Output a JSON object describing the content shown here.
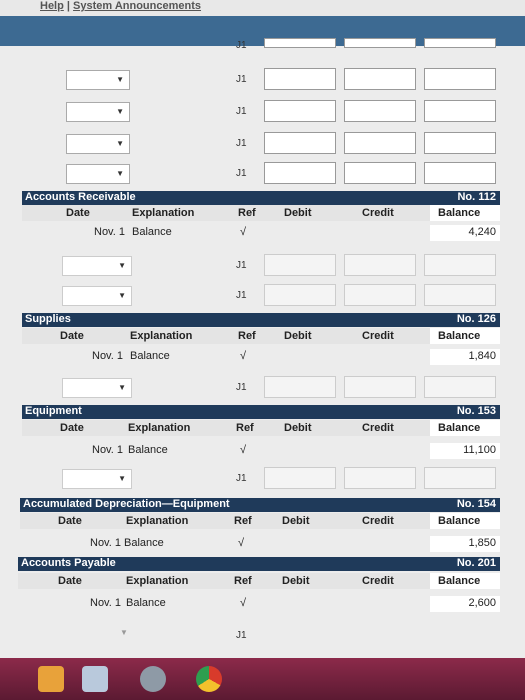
{
  "top_links": {
    "help": "Help",
    "separator": "|",
    "announcements": "System Announcements"
  },
  "journal_ref": "J1",
  "journal_rows": 5,
  "colors": {
    "header_bg": "#1f3a5a",
    "band": "#3d6a92",
    "taskbar": "#8c2a4a"
  },
  "columns": {
    "date": "Date",
    "explanation": "Explanation",
    "ref": "Ref",
    "debit": "Debit",
    "credit": "Credit",
    "balance": "Balance"
  },
  "accounts": [
    {
      "name": "Accounts Receivable",
      "number": "No. 112",
      "date": "Nov. 1",
      "explanation": "Balance",
      "ref": "√",
      "balance": "4,240"
    },
    {
      "name": "Supplies",
      "number": "No. 126",
      "date": "Nov. 1",
      "explanation": "Balance",
      "ref": "√",
      "balance": "1,840"
    },
    {
      "name": "Equipment",
      "number": "No. 153",
      "date": "Nov. 1",
      "explanation": "Balance",
      "ref": "√",
      "balance": "11,100"
    },
    {
      "name": "Accumulated Depreciation—Equipment",
      "number": "No. 154",
      "date": "Nov. 1",
      "explanation": "Balance",
      "ref": "√",
      "balance": "1,850"
    },
    {
      "name": "Accounts Payable",
      "number": "No. 201",
      "date": "Nov. 1",
      "explanation": "Balance",
      "ref": "√",
      "balance": "2,600"
    }
  ],
  "taskbar_icons": [
    "task-manager-icon",
    "notes-icon",
    "app-icon",
    "chrome-icon"
  ]
}
